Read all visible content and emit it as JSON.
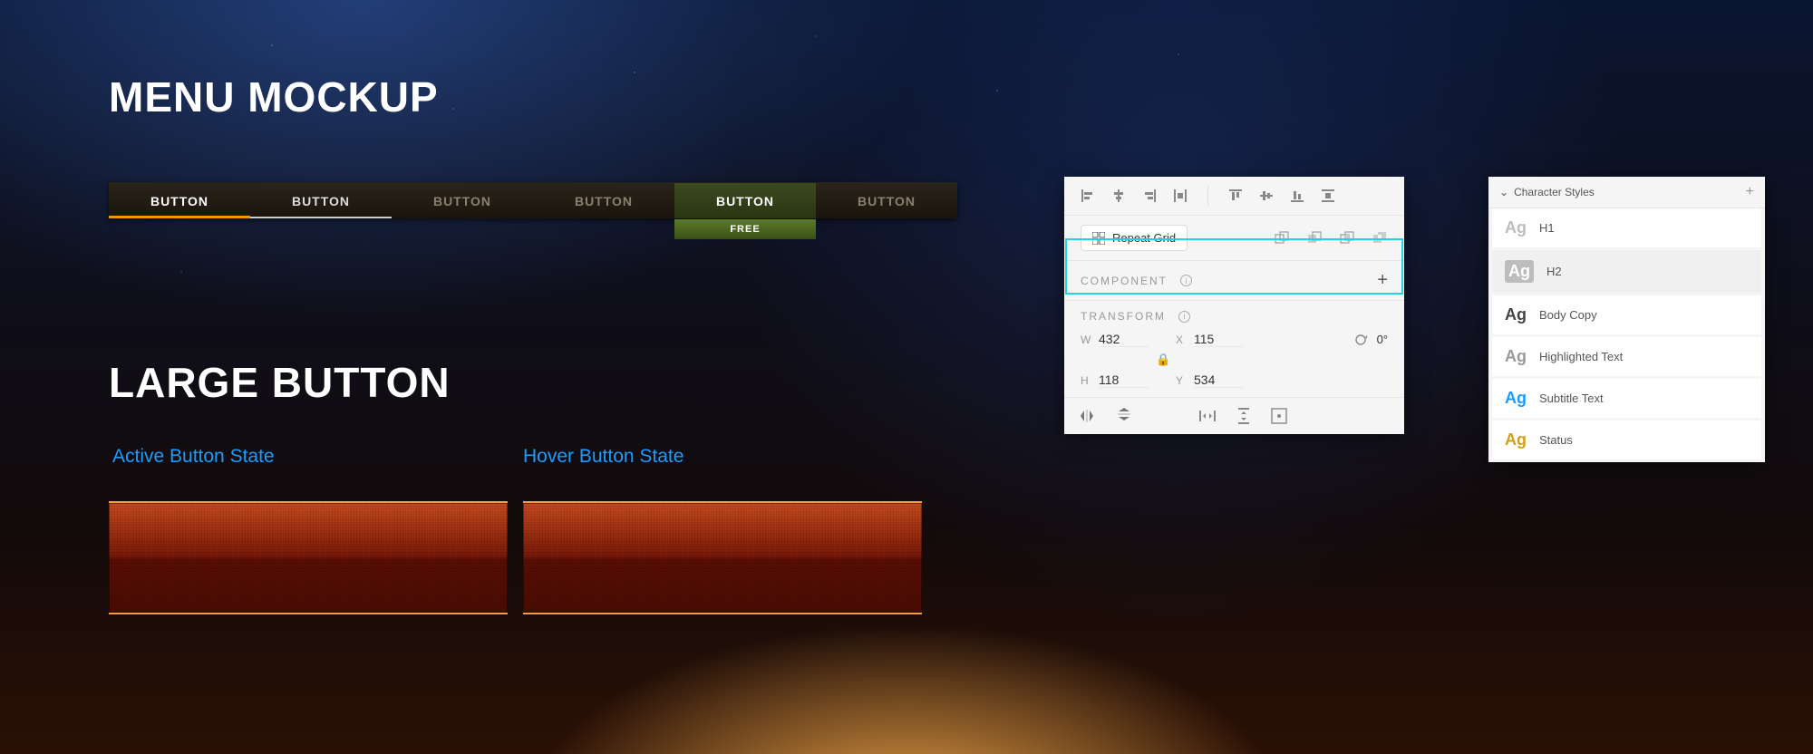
{
  "headings": {
    "menu": "MENU MOCKUP",
    "large": "LARGE BUTTON"
  },
  "nav": {
    "items": [
      {
        "label": "BUTTON",
        "state": "active"
      },
      {
        "label": "BUTTON",
        "state": "hover"
      },
      {
        "label": "BUTTON",
        "state": "default"
      },
      {
        "label": "BUTTON",
        "state": "default"
      },
      {
        "label": "BUTTON",
        "state": "drop"
      },
      {
        "label": "BUTTON",
        "state": "default"
      }
    ],
    "dropdown_tag": "FREE"
  },
  "states": {
    "active": "Active Button State",
    "hover": "Hover Button State"
  },
  "panel": {
    "repeat_grid": "Repeat Grid",
    "component_label": "COMPONENT",
    "transform_label": "TRANSFORM",
    "W": "432",
    "H": "118",
    "X": "115",
    "Y": "534",
    "rot": "0°"
  },
  "char_styles": {
    "title": "Character Styles",
    "items": [
      {
        "name": "H1",
        "ag_color": "#bdbdbd"
      },
      {
        "name": "H2",
        "ag_color": "#bdbdbd",
        "selected": true,
        "box": true
      },
      {
        "name": "Body Copy",
        "ag_color": "#444"
      },
      {
        "name": "Highlighted Text",
        "ag_color": "#9a9a9a"
      },
      {
        "name": "Subtitle Text",
        "ag_color": "#1a9cff"
      },
      {
        "name": "Status",
        "ag_color": "#d4a017"
      }
    ]
  }
}
